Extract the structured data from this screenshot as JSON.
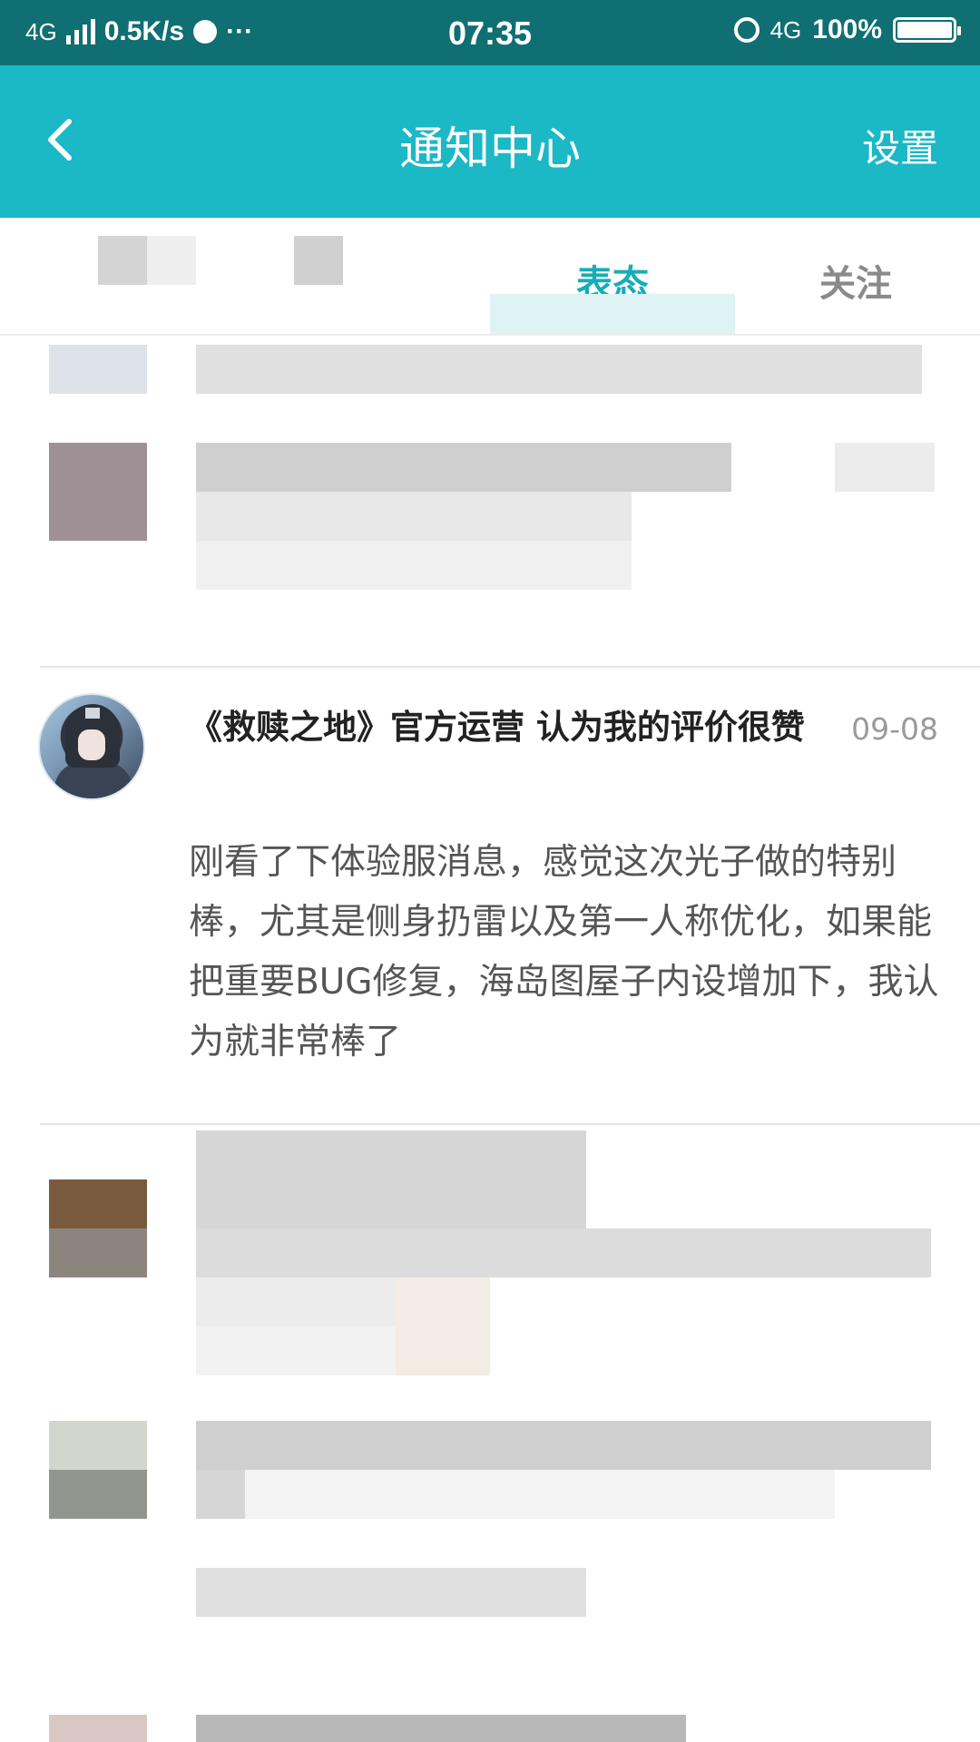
{
  "status_bar": {
    "network": "4G",
    "speed": "0.5K/s",
    "dots": "···",
    "time": "07:35",
    "network_right": "4G",
    "battery": "100%",
    "battery_level": 1.0
  },
  "header": {
    "title": "通知中心",
    "settings_label": "设置"
  },
  "tabs": {
    "reactions_label": "表态",
    "follows_label": "关注",
    "active": "表态"
  },
  "notification": {
    "title": "《救赎之地》官方运营 认为我的评价很赞",
    "time": "09-08",
    "body": "刚看了下体验服消息，感觉这次光子做的特别棒，尤其是侧身扔雷以及第一人称优化，如果能把重要BUG修复，海岛图屋子内设增加下，我认为就非常棒了"
  },
  "colors": {
    "status_bar": "#0f6f72",
    "header": "#1bb8c6",
    "accent": "#17adb8"
  }
}
